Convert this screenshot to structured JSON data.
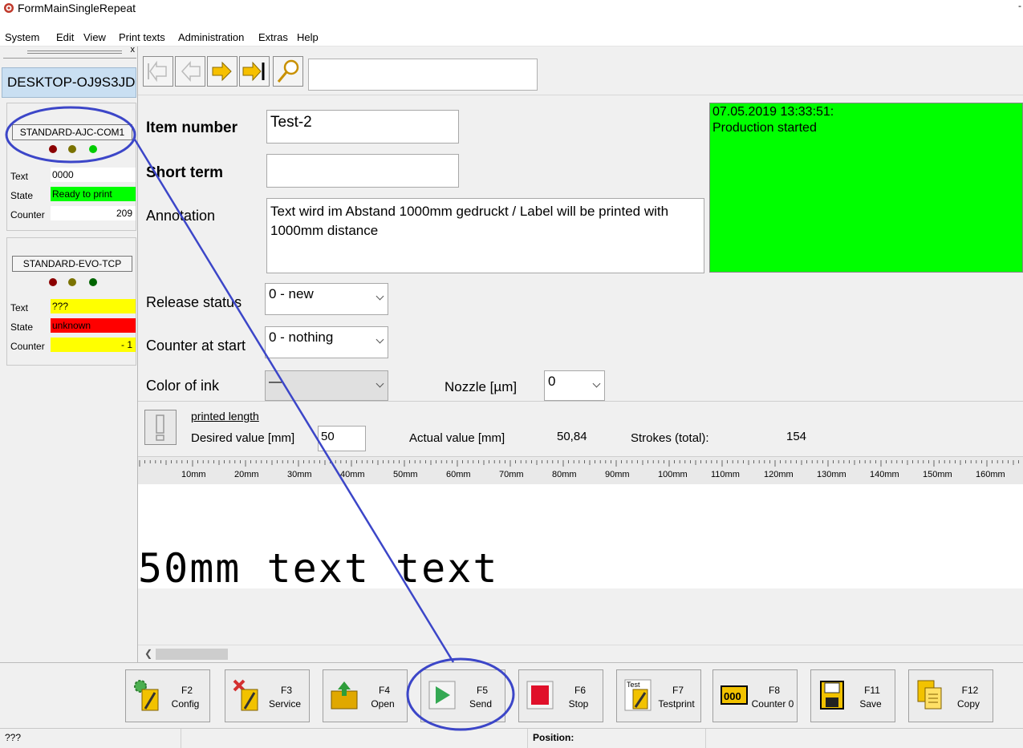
{
  "window": {
    "title": "FormMainSingleRepeat",
    "minimize_glyph": "-"
  },
  "menu": [
    "System",
    "Edit",
    "View",
    "Print texts",
    "Administration",
    "Extras",
    "Help"
  ],
  "sidebar": {
    "close_glyph": "x",
    "hostname": "DESKTOP-OJ9S3JD",
    "devices": [
      {
        "name": "STANDARD-AJC-COM1",
        "leds": [
          "#8b0000",
          "#7a7200",
          "#00cc00"
        ],
        "text_label": "Text",
        "text_value": "0000",
        "state_label": "State",
        "state_value": "Ready to print",
        "state_color": "#00ff00",
        "counter_label": "Counter",
        "counter_value": "209"
      },
      {
        "name": "STANDARD-EVO-TCP",
        "leds": [
          "#8b0000",
          "#7a7200",
          "#006400"
        ],
        "text_label": "Text",
        "text_value": "???",
        "text_color": "#ffff00",
        "state_label": "State",
        "state_value": "unknown",
        "state_color": "#ff0000",
        "counter_label": "Counter",
        "counter_value": "- 1",
        "counter_color": "#ffff00"
      }
    ]
  },
  "toolbar": {
    "buttons": [
      "first-record",
      "previous-record",
      "next-record",
      "last-record",
      "search"
    ],
    "search_value": ""
  },
  "form": {
    "item_number_label": "Item number",
    "item_number_value": "Test-2",
    "short_term_label": "Short term",
    "short_term_value": "",
    "annotation_label": "Annotation",
    "annotation_value": "Text wird im Abstand 1000mm gedruckt / Label will be printed with 1000mm distance",
    "release_status_label": "Release status",
    "release_status_value": "0 - new",
    "counter_at_start_label": "Counter at start",
    "counter_at_start_value": "0 - nothing",
    "color_of_ink_label": "Color of ink",
    "color_of_ink_value": "—",
    "nozzle_label": "Nozzle [µm]",
    "nozzle_value": "0"
  },
  "log": {
    "timestamp": "07.05.2019 13:33:51:",
    "message": "Production started",
    "background": "#00ff00"
  },
  "printed_length": {
    "title": "printed length",
    "desired_label": "Desired value [mm]",
    "desired_value": "50",
    "actual_label": "Actual value [mm]",
    "actual_value": "50,84",
    "strokes_label": "Strokes (total):",
    "strokes_value": "154"
  },
  "ruler": {
    "labels": [
      "10mm",
      "20mm",
      "30mm",
      "40mm",
      "50mm",
      "60mm",
      "70mm",
      "80mm",
      "90mm",
      "100mm",
      "110mm",
      "120mm",
      "130mm",
      "140mm",
      "150mm",
      "160mm"
    ]
  },
  "preview": {
    "text": "50mm text text"
  },
  "function_keys": [
    {
      "key": "F2",
      "label": "Config",
      "icon": "config-icon"
    },
    {
      "key": "F3",
      "label": "Service",
      "icon": "service-icon"
    },
    {
      "key": "F4",
      "label": "Open",
      "icon": "open-folder-icon"
    },
    {
      "key": "F5",
      "label": "Send",
      "icon": "play-icon"
    },
    {
      "key": "F6",
      "label": "Stop",
      "icon": "stop-icon"
    },
    {
      "key": "F7",
      "label": "Testprint",
      "icon": "testprint-icon",
      "icon_text": "Test"
    },
    {
      "key": "F8",
      "label": "Counter 0",
      "icon": "counter-reset-icon",
      "icon_text": "000"
    },
    {
      "key": "F11",
      "label": "Save",
      "icon": "save-icon"
    },
    {
      "key": "F12",
      "label": "Copy",
      "icon": "copy-icon"
    }
  ],
  "status_bar": {
    "left_text": "???",
    "position_label": "Position:"
  },
  "colors": {
    "highlight_annotation": "#3c46c8",
    "host_bg": "#c9dff2",
    "ok_green": "#00ff00",
    "warn_yellow": "#ffff00",
    "error_red": "#ff0000"
  }
}
